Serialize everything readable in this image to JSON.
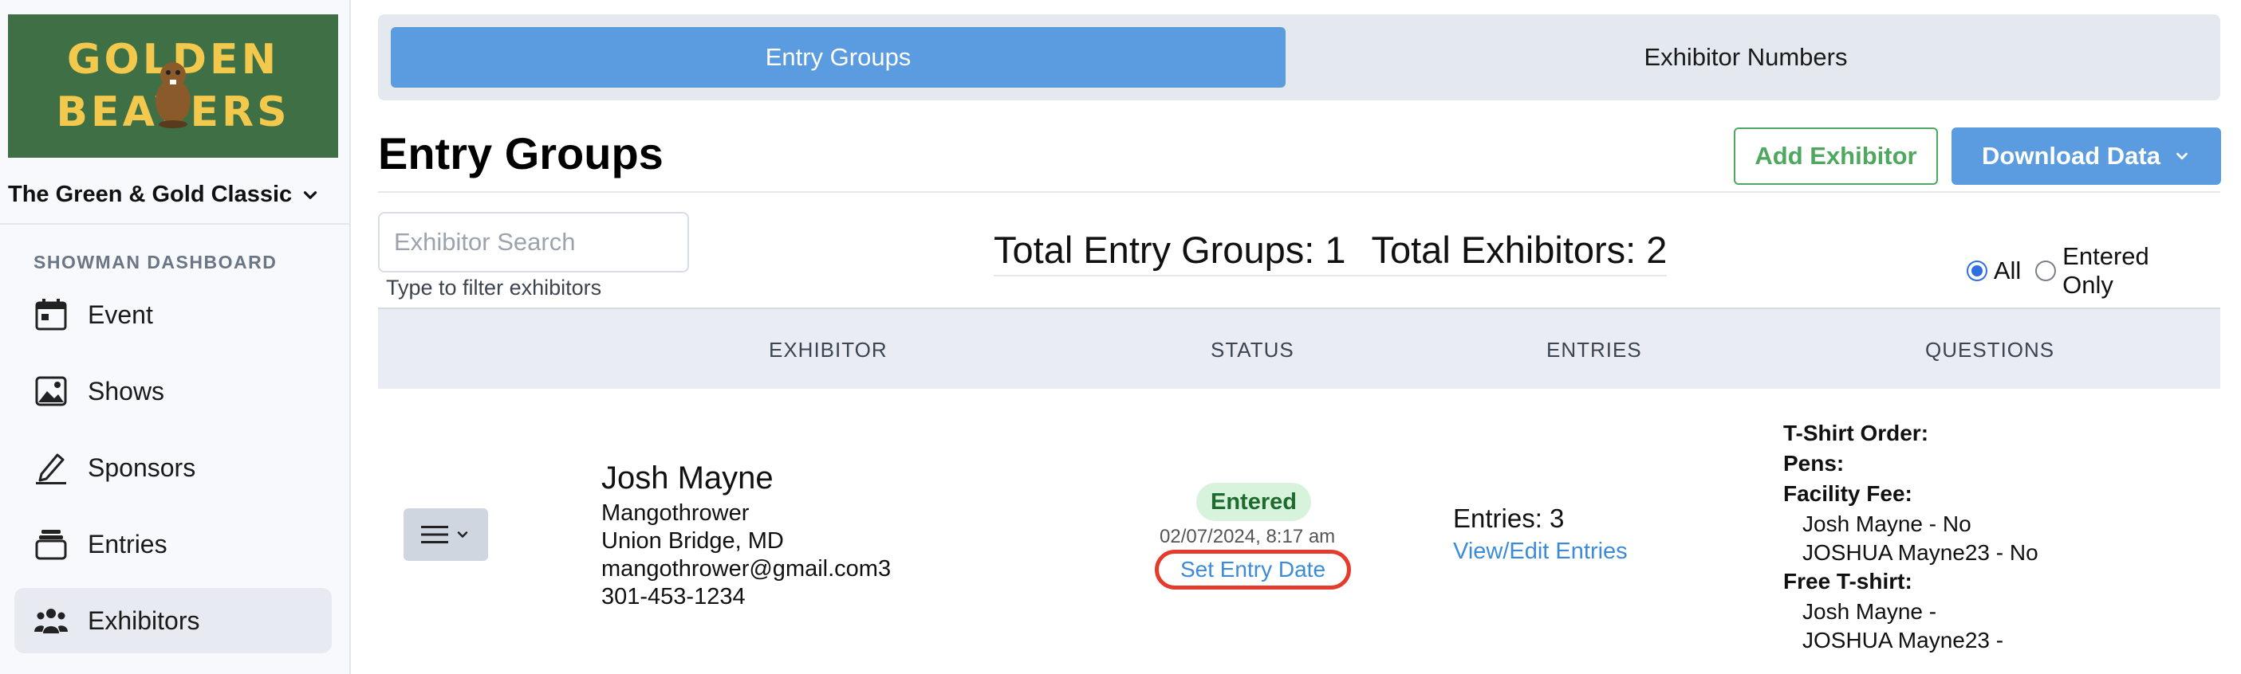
{
  "sidebar": {
    "logo_line1": "GOLDEN",
    "logo_line2": "BEAVERS",
    "event_name": "The Green & Gold Classic",
    "section_label": "SHOWMAN DASHBOARD",
    "items": [
      {
        "label": "Event",
        "icon": "calendar-icon"
      },
      {
        "label": "Shows",
        "icon": "image-icon"
      },
      {
        "label": "Sponsors",
        "icon": "pen-icon"
      },
      {
        "label": "Entries",
        "icon": "stack-icon"
      },
      {
        "label": "Exhibitors",
        "icon": "users-icon",
        "active": true
      }
    ]
  },
  "tabs": [
    {
      "label": "Entry Groups",
      "active": true
    },
    {
      "label": "Exhibitor Numbers",
      "active": false
    }
  ],
  "page": {
    "title": "Entry Groups",
    "add_button": "Add Exhibitor",
    "download_button": "Download Data"
  },
  "search": {
    "placeholder": "Exhibitor Search",
    "help": "Type to filter exhibitors"
  },
  "totals": {
    "groups": "Total Entry Groups: 1",
    "exhibitors": "Total Exhibitors: 2"
  },
  "filter": {
    "all_label": "All",
    "entered_label": "Entered Only",
    "selected": "All"
  },
  "table": {
    "headers": [
      "EXHIBITOR",
      "STATUS",
      "ENTRIES",
      "QUESTIONS"
    ],
    "rows": [
      {
        "name": "Josh Mayne",
        "farm": "Mangothrower",
        "location": "Union Bridge, MD",
        "email": "mangothrower@gmail.com3",
        "phone": "301-453-1234",
        "status": "Entered",
        "status_date": "02/07/2024, 8:17 am",
        "set_entry_date": "Set Entry Date",
        "entries": "Entries: 3",
        "view_entries": "View/Edit Entries",
        "questions": [
          {
            "q": "T-Shirt Order:",
            "answers": []
          },
          {
            "q": "Pens:",
            "answers": []
          },
          {
            "q": "Facility Fee:",
            "answers": [
              "Josh Mayne - No",
              "JOSHUA Mayne23 - No"
            ]
          },
          {
            "q": "Free T-shirt:",
            "answers": [
              "Josh Mayne -",
              "JOSHUA Mayne23 -"
            ]
          }
        ]
      }
    ]
  },
  "colors": {
    "primary": "#5b9be0",
    "success": "#4ea85f",
    "logo_bg": "#3e6f45",
    "logo_text": "#f2c94c",
    "highlight": "#e53b2c"
  }
}
